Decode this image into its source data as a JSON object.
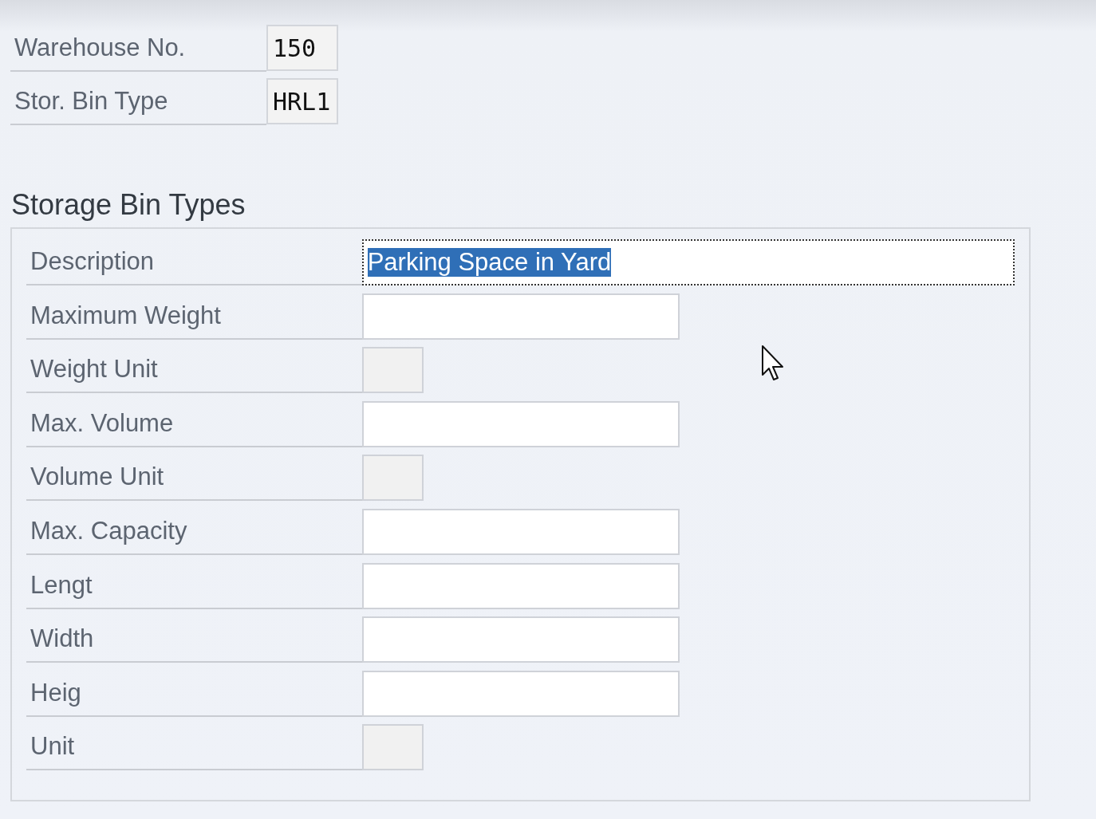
{
  "header_fields": [
    {
      "label": "Warehouse No.",
      "value": "150"
    },
    {
      "label": "Stor. Bin Type",
      "value": "HRL1"
    }
  ],
  "section": {
    "title": "Storage Bin Types",
    "fields": [
      {
        "label": "Description",
        "kind": "full",
        "value": "Parking Space in Yard",
        "focused": true,
        "selected": true
      },
      {
        "label": "Maximum Weight",
        "kind": "wide",
        "focused": false
      },
      {
        "label": "Weight Unit",
        "kind": "small",
        "focused": false
      },
      {
        "label": "Max. Volume",
        "kind": "wide",
        "focused": false
      },
      {
        "label": "Volume Unit",
        "kind": "small",
        "focused": false
      },
      {
        "label": "Max. Capacity",
        "kind": "wide",
        "focused": false
      },
      {
        "label": "Lengt",
        "kind": "wide",
        "focused": false
      },
      {
        "label": "Width",
        "kind": "wide",
        "focused": false
      },
      {
        "label": "Heig",
        "kind": "wide",
        "focused": false
      },
      {
        "label": "Unit",
        "kind": "small",
        "focused": false
      }
    ]
  }
}
